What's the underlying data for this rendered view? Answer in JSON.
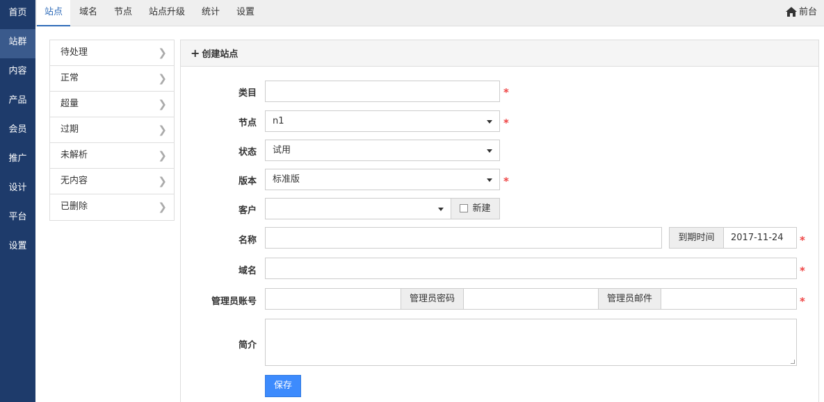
{
  "leftnav": {
    "items": [
      {
        "label": "首页"
      },
      {
        "label": "站群"
      },
      {
        "label": "内容"
      },
      {
        "label": "产品"
      },
      {
        "label": "会员"
      },
      {
        "label": "推广"
      },
      {
        "label": "设计"
      },
      {
        "label": "平台"
      },
      {
        "label": "设置"
      }
    ]
  },
  "topbar": {
    "tabs": [
      {
        "label": "站点"
      },
      {
        "label": "域名"
      },
      {
        "label": "节点"
      },
      {
        "label": "站点升级"
      },
      {
        "label": "统计"
      },
      {
        "label": "设置"
      }
    ],
    "front_label": "前台"
  },
  "sublist": {
    "items": [
      {
        "label": "待处理"
      },
      {
        "label": "正常"
      },
      {
        "label": "超量"
      },
      {
        "label": "过期"
      },
      {
        "label": "未解析"
      },
      {
        "label": "无内容"
      },
      {
        "label": "已删除"
      }
    ]
  },
  "form": {
    "title": "创建站点",
    "category_label": "类目",
    "category_value": "",
    "node_label": "节点",
    "node_value": "n1",
    "status_label": "状态",
    "status_value": "试用",
    "edition_label": "版本",
    "edition_value": "标准版",
    "customer_label": "客户",
    "customer_value": "",
    "new_label": "新建",
    "name_label": "名称",
    "name_value": "",
    "expiry_label": "到期时间",
    "expiry_value": "2017-11-24",
    "domain_label": "域名",
    "domain_value": "",
    "admin_account_label": "管理员账号",
    "admin_password_label": "管理员密码",
    "admin_email_label": "管理员邮件",
    "intro_label": "简介",
    "save_label": "保存",
    "required_mark": "*"
  },
  "colors": {
    "sidebar": "#1e3b6b",
    "accent": "#2d6ab8",
    "button": "#3d8bfd",
    "required": "#e44444"
  }
}
